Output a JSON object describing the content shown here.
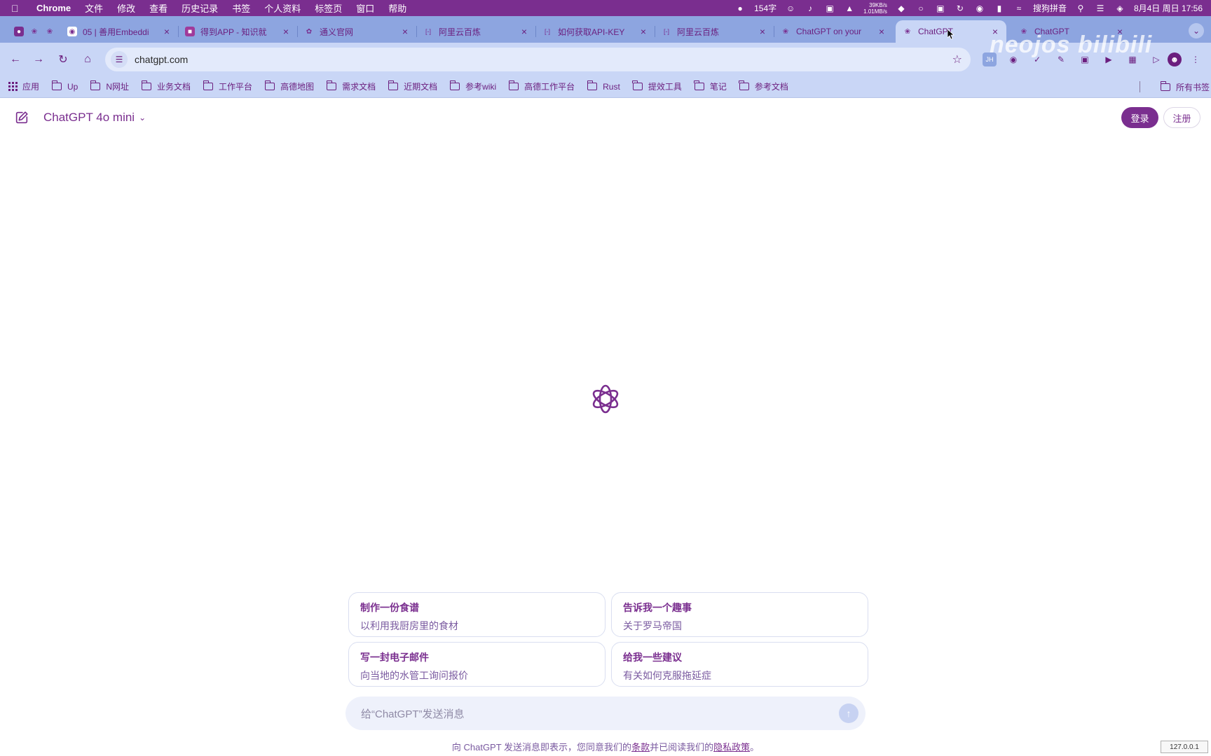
{
  "menubar": {
    "app_name": "Chrome",
    "items": [
      "文件",
      "修改",
      "查看",
      "历史记录",
      "书签",
      "个人资料",
      "标签页",
      "窗口",
      "帮助"
    ],
    "word_count": "154字",
    "net_up": "39KB/s",
    "net_down": "1.01MB/s",
    "input_method": "搜狗拼音",
    "datetime": "8月4日 周日 17:56"
  },
  "tabs": [
    {
      "title": "",
      "favicon": "pinned-icons"
    },
    {
      "title": "05 | 善用Embeddi",
      "favicon": "github-icon"
    },
    {
      "title": "得到APP - 知识就",
      "favicon": "dedao-icon"
    },
    {
      "title": "通义官网",
      "favicon": "tongyi-icon"
    },
    {
      "title": "阿里云百炼",
      "favicon": "aliyun-icon"
    },
    {
      "title": "如何获取API-KEY",
      "favicon": "aliyun-icon"
    },
    {
      "title": "阿里云百炼",
      "favicon": "aliyun-icon"
    },
    {
      "title": "ChatGPT on your",
      "favicon": "openai-icon"
    },
    {
      "title": "ChatGPT",
      "favicon": "openai-icon"
    },
    {
      "title": "ChatGPT",
      "favicon": "openai-icon"
    }
  ],
  "active_tab_index": 8,
  "omnibox": {
    "url": "chatgpt.com"
  },
  "bookmarks": {
    "apps": "应用",
    "folders": [
      "Up",
      "N网址",
      "业务文档",
      "工作平台",
      "高德地图",
      "需求文档",
      "近期文档",
      "参考wiki",
      "高德工作平台",
      "Rust",
      "提效工具",
      "笔记",
      "参考文档"
    ],
    "all": "所有书签"
  },
  "page": {
    "model_name": "ChatGPT 4o mini",
    "login": "登录",
    "signup": "注册",
    "suggestions": [
      {
        "title": "制作一份食谱",
        "subtitle": "以利用我厨房里的食材"
      },
      {
        "title": "告诉我一个趣事",
        "subtitle": "关于罗马帝国"
      },
      {
        "title": "写一封电子邮件",
        "subtitle": "向当地的水管工询问报价"
      },
      {
        "title": "给我一些建议",
        "subtitle": "有关如何克服拖延症"
      }
    ],
    "composer_placeholder": "给“ChatGPT”发送消息",
    "footer_prefix": "向 ChatGPT 发送消息即表示，您同意我们的",
    "footer_terms": "条款",
    "footer_middle": "并已阅读我们的",
    "footer_privacy": "隐私政策",
    "footer_suffix": "。"
  },
  "watermark": "neojos bilibili",
  "ip_badge": "127.0.0.1",
  "colors": {
    "accent": "#7a2e8f",
    "tabstrip": "#8da5e0",
    "toolbar": "#c9d6f6"
  }
}
